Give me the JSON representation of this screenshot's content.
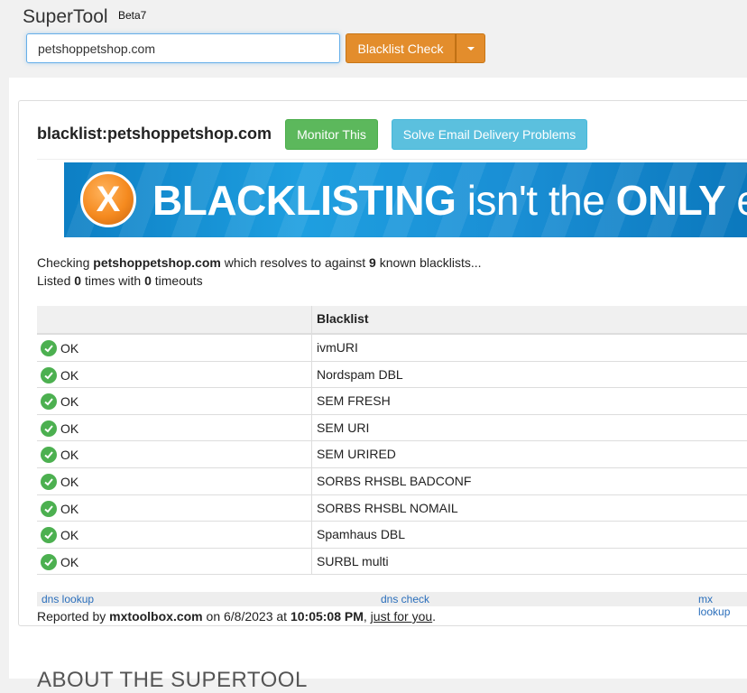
{
  "brand": {
    "name": "SuperTool",
    "beta": "Beta7"
  },
  "search": {
    "value": "petshoppetshop.com",
    "button_label": "Blacklist Check"
  },
  "result": {
    "heading": "blacklist:petshoppetshop.com",
    "monitor_label": "Monitor This",
    "solve_label": "Solve Email Delivery Problems"
  },
  "banner": {
    "icon_letter": "X",
    "word1": "BLACKLISTING",
    "word2": "isn't the",
    "word3": "ONLY",
    "word4": "e"
  },
  "info": {
    "checking_prefix": "Checking",
    "domain": "petshoppetshop.com",
    "checking_mid": "which resolves to against",
    "count": "9",
    "checking_suffix": "known blacklists...",
    "listed_prefix": "Listed",
    "listed_count": "0",
    "listed_mid": "times with",
    "timeouts": "0",
    "listed_suffix": "timeouts"
  },
  "table": {
    "header_blacklist": "Blacklist",
    "rows": [
      {
        "status": "OK",
        "blacklist": "ivmURI"
      },
      {
        "status": "OK",
        "blacklist": "Nordspam DBL"
      },
      {
        "status": "OK",
        "blacklist": "SEM FRESH"
      },
      {
        "status": "OK",
        "blacklist": "SEM URI"
      },
      {
        "status": "OK",
        "blacklist": "SEM URIRED"
      },
      {
        "status": "OK",
        "blacklist": "SORBS RHSBL BADCONF"
      },
      {
        "status": "OK",
        "blacklist": "SORBS RHSBL NOMAIL"
      },
      {
        "status": "OK",
        "blacklist": "Spamhaus DBL"
      },
      {
        "status": "OK",
        "blacklist": "SURBL multi"
      }
    ]
  },
  "footer": {
    "links": [
      "dns lookup",
      "dns check",
      "mx lookup"
    ],
    "reported_prefix": "Reported by",
    "reporter": "mxtoolbox.com",
    "on": "on 6/8/2023 at",
    "time": "10:05:08 PM",
    "just_for_you": "just for you"
  },
  "about_heading": "ABOUT THE SUPERTOOL"
}
